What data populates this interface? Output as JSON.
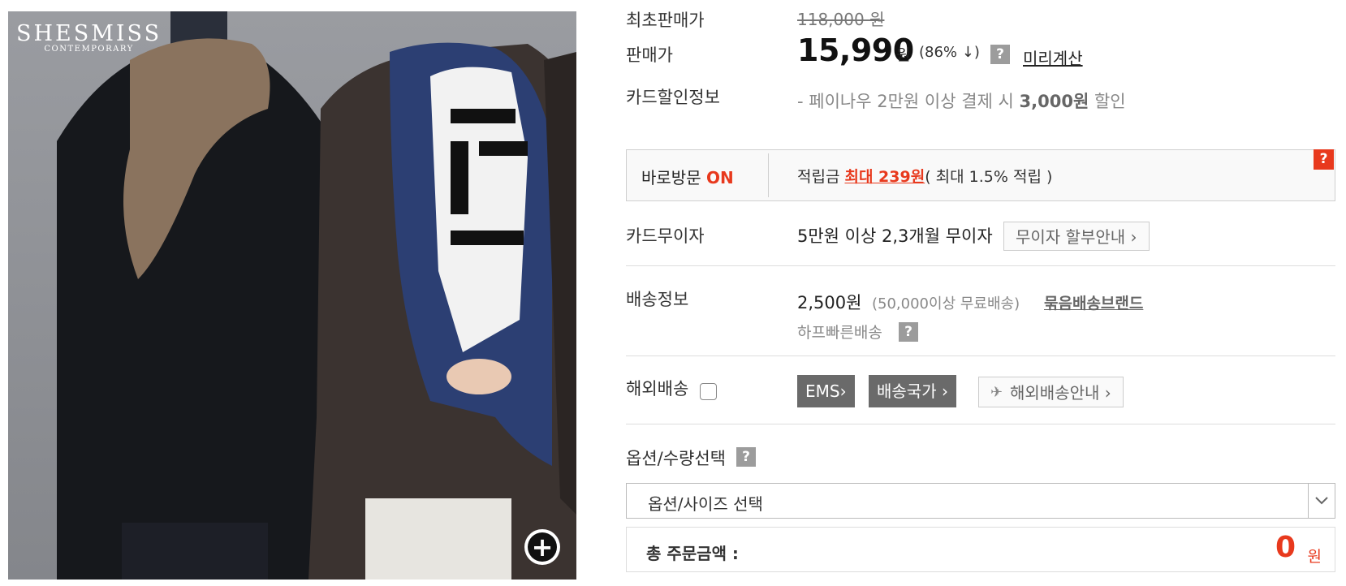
{
  "brand": {
    "name": "SHESMISS",
    "tagline": "CONTEMPORARY"
  },
  "price": {
    "original_label": "최초판매가",
    "original_value": "118,000 원",
    "sale_label": "판매가",
    "sale_value": "15,990",
    "sale_unit": "원",
    "discount": "(86% ↓)",
    "help_icon": "?",
    "precalc_link": "미리계산"
  },
  "card_info": {
    "label": "카드할인정보",
    "text_prefix": "- 페이나우 2만원 이상 결제 시 ",
    "text_amount": "3,000원",
    "text_suffix": " 할인"
  },
  "visit": {
    "label": "바로방문",
    "status": "ON",
    "points_label": "적립금 ",
    "points_highlight": "최대 239원",
    "points_suffix": "( 최대 1.5% 적립 )",
    "help_icon": "?"
  },
  "card_installment": {
    "label": "카드무이자",
    "text": "5만원 이상 2,3개월 무이자",
    "button": "무이자 할부안내 ›"
  },
  "shipping": {
    "label": "배송정보",
    "fee": "2,500원",
    "free_note": "(50,000이상 무료배송)",
    "bundle_link": "묶음배송브랜드",
    "fast": "하프빠른배송",
    "help_icon": "?"
  },
  "overseas": {
    "label": "해외배송",
    "ems_button": "EMS›",
    "country_button": "배송국가 ›",
    "guide_button": "해외배송안내 ›"
  },
  "options": {
    "label": "옵션/수량선택",
    "help_icon": "?",
    "select_text": "옵션/사이즈 선택"
  },
  "total": {
    "label": "총 주문금액 :",
    "amount": "0",
    "unit": "원"
  },
  "colors": {
    "accent": "#e8391d",
    "gray_badge": "#9c9c9c",
    "dark_button": "#6a6a6a"
  }
}
